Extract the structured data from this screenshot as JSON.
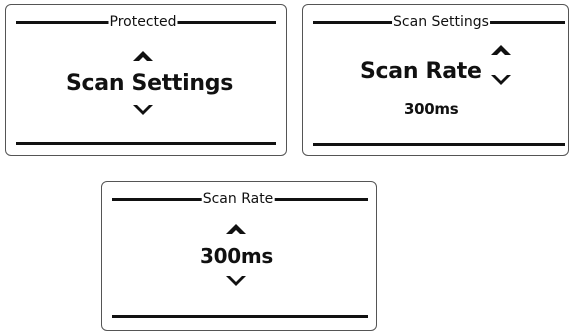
{
  "screens": [
    {
      "header": "Protected",
      "main": "Scan Settings",
      "sub": ""
    },
    {
      "header": "Scan Settings",
      "main": "Scan Rate",
      "sub": "300ms"
    },
    {
      "header": "Scan Rate",
      "main": "300ms",
      "sub": ""
    }
  ],
  "icons": {
    "up": "chevron-up-icon",
    "down": "chevron-down-icon"
  }
}
